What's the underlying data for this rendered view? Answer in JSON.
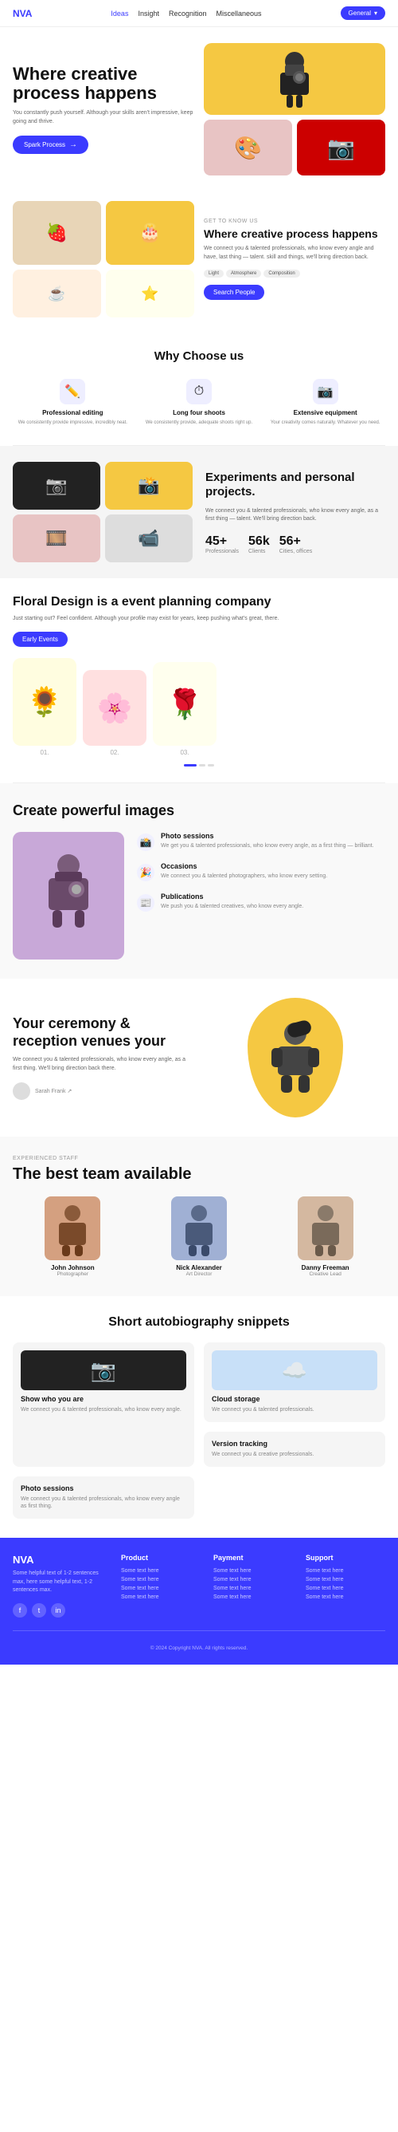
{
  "nav": {
    "logo": "NVA",
    "links": [
      "Ideas",
      "Insight",
      "Recognition",
      "Miscellaneous"
    ],
    "btn_label": "General",
    "active_link": "Ideas"
  },
  "hero": {
    "title": "Where creative process happens",
    "desc": "You constantly push yourself. Although your skills aren't impressive, keep going and thrive.",
    "btn_label": "Spark Process",
    "img_top_emoji": "📷",
    "img_bl_emoji": "🎨",
    "img_br_emoji": "📸"
  },
  "section2": {
    "label": "GET TO KNOW US",
    "title": "Where creative process happens",
    "desc": "We connect you & talented professionals, who know every angle and have, last thing  — talent. skill and things, we'll bring direction back.",
    "tags": [
      "Light",
      "Atmosphere",
      "Composition"
    ],
    "btn_label": "Search People"
  },
  "why": {
    "title": "Why Choose us",
    "cards": [
      {
        "icon": "✏️",
        "title": "Professional editing",
        "desc": "We consistently provide impressive, incredibly neat."
      },
      {
        "icon": "⏱",
        "title": "Long four shoots",
        "desc": "We consistently provide, adequate shoots right up."
      },
      {
        "icon": "📷",
        "title": "Extensive equipment",
        "desc": "Your creativity comes naturally. Whatever you need."
      }
    ]
  },
  "experiments": {
    "title": "Experiments and personal projects.",
    "desc": "We connect you & talented professionals, who know every angle, as a first thing — talent. We'll bring direction back.",
    "stats": [
      {
        "num": "45+",
        "label": "Professionals"
      },
      {
        "num": "56k",
        "label": "Clients"
      },
      {
        "num": "56+",
        "label": "Cities, offices"
      }
    ]
  },
  "floral": {
    "title": "Floral Design is a event planning company",
    "desc": "Just starting out? Feel confident. Although your profile may exist for years, keep pushing what's great, there.",
    "btn_label": "Early Events",
    "nums": [
      "01.",
      "02.",
      "03."
    ]
  },
  "powerful": {
    "title": "Create powerful images",
    "items": [
      {
        "icon": "📸",
        "title": "Photo sessions",
        "desc": "We get you & talented professionals, who know every angle, as a first thing — brilliant."
      },
      {
        "icon": "🎉",
        "title": "Occasions",
        "desc": "We connect you & talented photographers, who know every setting."
      },
      {
        "icon": "📰",
        "title": "Publications",
        "desc": "We push you & talented creatives, who know every angle."
      }
    ]
  },
  "ceremony": {
    "title": "Your ceremony & reception venues your",
    "desc": "We connect you & talented professionals, who know every angle, as a first thing. We'll bring direction back there.",
    "author_name": "Sarah Frank ↗"
  },
  "team": {
    "label": "EXPERIENCED STAFF",
    "title": "The best team available",
    "members": [
      {
        "name": "John Johnson",
        "role": "Photographer"
      },
      {
        "name": "Nick Alexander",
        "role": "Art Director"
      },
      {
        "name": "Danny Freeman",
        "role": "Creative Lead"
      }
    ]
  },
  "autobiography": {
    "title": "Short autobiography snippets",
    "cards": [
      {
        "type": "img-camera",
        "title": "Show who you are",
        "desc": "We connect you & talented professionals, who know every angle."
      },
      {
        "type": "img-boxes",
        "title": "Cloud storage",
        "desc": "We connect you & talented professionals."
      },
      {
        "type": "text",
        "title": "Photo sessions",
        "desc": "We connect you & talented professionals, who know every angle as first thing."
      },
      {
        "type": "text",
        "title": "Version tracking",
        "desc": "We connect you & creative professionals."
      }
    ]
  },
  "footer": {
    "logo": "NVA",
    "brand_desc": "Some helpful text of 1-2 sentences max, here some helpful text, 1-2 sentences max.",
    "columns": [
      {
        "title": "Product",
        "links": [
          "Some text here",
          "Some text here",
          "Some text here",
          "Some text here"
        ]
      },
      {
        "title": "Payment",
        "links": [
          "Some text here",
          "Some text here",
          "Some text here",
          "Some text here"
        ]
      },
      {
        "title": "Support",
        "links": [
          "Some text here",
          "Some text here",
          "Some text here",
          "Some text here"
        ]
      }
    ],
    "copy": "© 2024 Copyright NVA. All rights reserved."
  }
}
